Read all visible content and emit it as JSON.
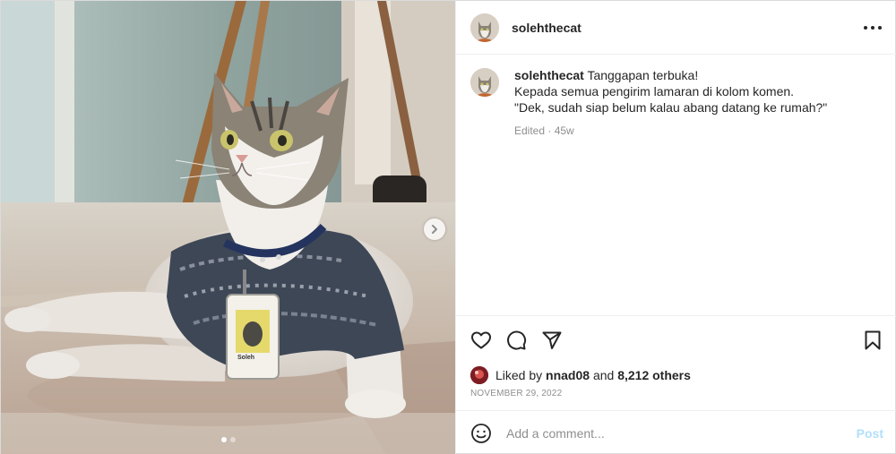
{
  "post": {
    "author": {
      "username": "solehthecat",
      "avatar_icon": "cat-avatar"
    },
    "media": {
      "carousel_dots": 2,
      "active_dot": 0,
      "next_icon": "chevron-right-icon",
      "badge_text": "Soleh"
    },
    "header": {
      "more_icon": "more-horizontal-icon"
    },
    "caption": {
      "username": "solehthecat",
      "lines": [
        "Tanggapan terbuka!",
        "Kepada semua pengirim lamaran di kolom komen.",
        "\"Dek, sudah siap belum kalau abang datang ke rumah?\""
      ],
      "meta": "Edited · 45w"
    },
    "actions": {
      "like_icon": "heart-icon",
      "comment_icon": "comment-icon",
      "share_icon": "send-icon",
      "save_icon": "bookmark-icon"
    },
    "likes": {
      "prefix": "Liked by",
      "user": "nnad08",
      "and": "and",
      "others": "8,212 others"
    },
    "date": "NOVEMBER 29, 2022",
    "comment_box": {
      "emoji_icon": "smile-icon",
      "placeholder": "Add a comment...",
      "post_label": "Post"
    },
    "colors": {
      "text": "#262626",
      "muted": "#8e8e8e",
      "post_disabled": "#b2dffc",
      "border": "#efefef"
    }
  }
}
